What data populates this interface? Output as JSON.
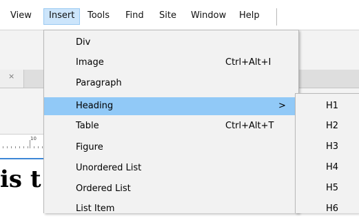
{
  "menubar": {
    "items": [
      "View",
      "Insert",
      "Tools",
      "Find",
      "Site",
      "Window",
      "Help"
    ],
    "active": "Insert"
  },
  "document": {
    "tab_close": "×",
    "ruler_number": "10",
    "heading_text": "is t"
  },
  "insert_menu": {
    "items": [
      {
        "label": "Div",
        "shortcut": ""
      },
      {
        "label": "Image",
        "shortcut": "Ctrl+Alt+I"
      },
      {
        "label": "Paragraph",
        "shortcut": ""
      },
      {
        "label": "Heading",
        "shortcut": "",
        "submenu_arrow": ">",
        "highlighted": true
      },
      {
        "label": "Table",
        "shortcut": "Ctrl+Alt+T"
      },
      {
        "label": "Figure",
        "shortcut": ""
      },
      {
        "label": "Unordered List",
        "shortcut": ""
      },
      {
        "label": "Ordered List",
        "shortcut": ""
      },
      {
        "label": "List Item",
        "shortcut": ""
      }
    ]
  },
  "heading_submenu": {
    "items": [
      "H1",
      "H2",
      "H3",
      "H4",
      "H5",
      "H6"
    ]
  },
  "colors": {
    "highlight": "#91c9f7",
    "active_menubar": "#cce5fb",
    "menu_background": "#f2f2f2"
  }
}
